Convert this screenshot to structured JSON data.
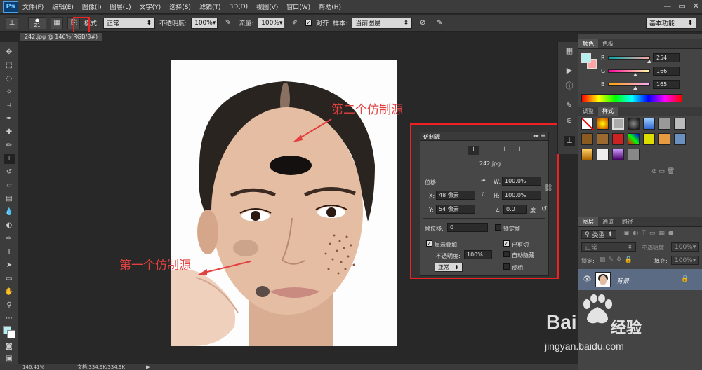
{
  "app": {
    "logo": "Ps",
    "menu": [
      "文件(F)",
      "编辑(E)",
      "图像(I)",
      "图层(L)",
      "文字(Y)",
      "选择(S)",
      "滤镜(T)",
      "3D(D)",
      "视图(V)",
      "窗口(W)",
      "帮助(H)"
    ]
  },
  "options": {
    "brush_size": "21",
    "mode_label": "模式:",
    "mode_value": "正常",
    "opacity_label": "不透明度:",
    "opacity_value": "100%",
    "flow_label": "流量:",
    "flow_value": "100%",
    "align_label": "对齐",
    "sample_label": "样本:",
    "sample_value": "当前图层",
    "workspace": "基本功能"
  },
  "document": {
    "tab_title": "242.jpg @ 146%(RGB/8#) *"
  },
  "annotations": {
    "second_source": "第二个仿制源",
    "first_source": "第一个仿制源"
  },
  "clone_source": {
    "title": "仿制源",
    "filename": "242.jpg",
    "offset_label": "位移:",
    "x_label": "X:",
    "x_value": "48 像素",
    "y_label": "Y:",
    "y_value": "54 像素",
    "w_label": "W:",
    "w_value": "100.0%",
    "h_label": "H:",
    "h_value": "100.0%",
    "angle_value": "0.0",
    "angle_unit": "度",
    "frame_offset_label": "帧位移:",
    "frame_offset_value": "0",
    "lock_frame_label": "锁定帧",
    "show_overlay_label": "显示叠加",
    "show_overlay_checked": true,
    "overlay_opacity_label": "不透明度:",
    "overlay_opacity_value": "100%",
    "clipped_label": "已剪切",
    "clipped_checked": true,
    "auto_hide_label": "自动隐藏",
    "auto_hide_checked": false,
    "invert_label": "反相",
    "invert_checked": false,
    "blend_mode": "正常"
  },
  "color_panel": {
    "tabs": [
      "颜色",
      "色板"
    ],
    "r_label": "R",
    "r_value": "254",
    "g_label": "G",
    "g_value": "166",
    "b_label": "B",
    "b_value": "165",
    "fg_color": "#b7eff0",
    "r_fraction": 0.996,
    "g_fraction": 0.651,
    "b_fraction": 0.647
  },
  "styles_panel": {
    "tabs": [
      "调整",
      "样式"
    ]
  },
  "layers_panel": {
    "tabs": [
      "图层",
      "通道",
      "路径"
    ],
    "filter_label": "类型",
    "blend_mode": "正常",
    "opacity_label": "不透明度:",
    "opacity_value": "100%",
    "lock_label": "锁定:",
    "fill_label": "填充:",
    "fill_value": "100%",
    "layer_name": "背景"
  },
  "status": {
    "zoom": "146.41%",
    "doc_info": "文档:334.9K/334.9K"
  },
  "watermark": {
    "brand": "Bai",
    "brand_suffix": "经验",
    "url": "jingyan.baidu.com"
  }
}
